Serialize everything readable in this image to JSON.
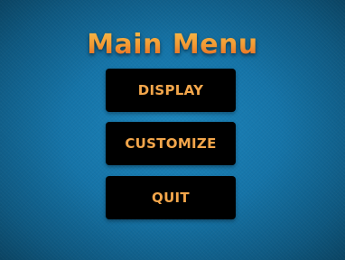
{
  "menu": {
    "title": "Main Menu",
    "buttons": [
      {
        "label": "DISPLAY"
      },
      {
        "label": "CUSTOMIZE"
      },
      {
        "label": "QUIT"
      }
    ]
  },
  "colors": {
    "background": "#1574a8",
    "title_top": "#f6c04e",
    "title_bottom": "#e0531c",
    "button_bg": "#000000",
    "button_text": "#f3a64b"
  }
}
